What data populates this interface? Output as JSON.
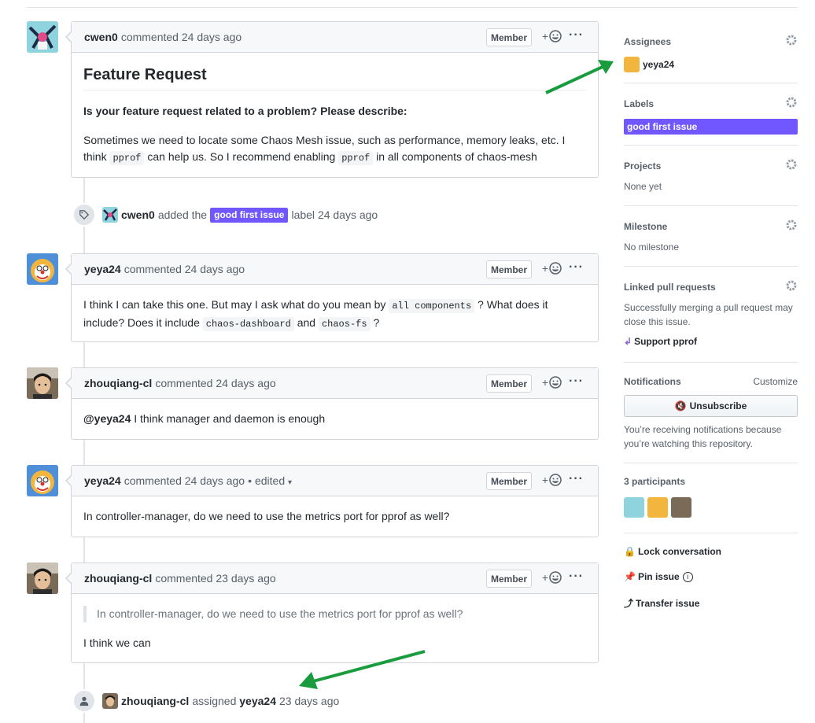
{
  "comments": [
    {
      "author": "cwen0",
      "action": "commented",
      "time": "24 days ago",
      "role": "Member",
      "title": "Feature Request",
      "question": "Is your feature request related to a problem? Please describe:",
      "body_pre": "Sometimes we need to locate some Chaos Mesh issue, such as performance, memory leaks, etc. I think",
      "code1": "pprof",
      "body_mid": "can help us. So I recommend enabling",
      "code2": "pprof",
      "body_post": "in all components of chaos-mesh"
    },
    {
      "author": "yeya24",
      "action": "commented",
      "time": "24 days ago",
      "role": "Member",
      "body_pre": "I think I can take this one. But may I ask what do you mean by",
      "code1": "all components",
      "body_mid": "? What does it include? Does it include",
      "code2": "chaos-dashboard",
      "body_and": "and",
      "code3": "chaos-fs",
      "body_post": "?"
    },
    {
      "author": "zhouqiang-cl",
      "action": "commented",
      "time": "24 days ago",
      "role": "Member",
      "mention": "@yeya24",
      "body": "I think manager and daemon is enough"
    },
    {
      "author": "yeya24",
      "action": "commented",
      "time": "24 days ago",
      "edited": "edited",
      "role": "Member",
      "body": "In controller-manager, do we need to use the metrics port for pprof as well?"
    },
    {
      "author": "zhouqiang-cl",
      "action": "commented",
      "time": "23 days ago",
      "role": "Member",
      "quote": "In controller-manager, do we need to use the metrics port for pprof as well?",
      "body": "I think we can"
    }
  ],
  "events": [
    {
      "actor": "cwen0",
      "verb": "added the",
      "label": "good first issue",
      "suffix": "label",
      "time": "24 days ago"
    },
    {
      "actor": "zhouqiang-cl",
      "verb": "assigned",
      "target": "yeya24",
      "time": "23 days ago"
    }
  ],
  "reaction_plus": "+",
  "more_dots": "···",
  "dot_sep": "•",
  "sidebar": {
    "assignees": {
      "title": "Assignees",
      "user": "yeya24"
    },
    "labels": {
      "title": "Labels",
      "label": "good first issue"
    },
    "projects": {
      "title": "Projects",
      "value": "None yet"
    },
    "milestone": {
      "title": "Milestone",
      "value": "No milestone"
    },
    "linked": {
      "title": "Linked pull requests",
      "desc": "Successfully merging a pull request may close this issue.",
      "pr": "Support pprof"
    },
    "notifications": {
      "title": "Notifications",
      "customize": "Customize",
      "button": "Unsubscribe",
      "desc": "You’re receiving notifications because you’re watching this repository."
    },
    "participants": {
      "title": "3 participants"
    },
    "actions": {
      "lock": "Lock conversation",
      "pin": "Pin issue",
      "transfer": "Transfer issue"
    }
  },
  "colors": {
    "label": "#7057ff",
    "annotation_arrow": "#1a9c3e"
  }
}
